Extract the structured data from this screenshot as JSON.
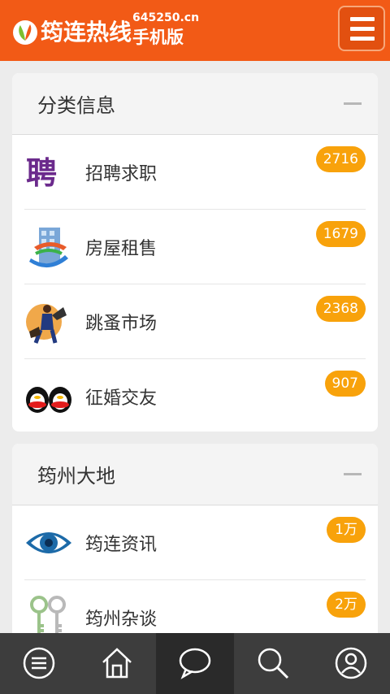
{
  "header": {
    "logo_icon": "leaf-logo-icon",
    "title": "筠连热线",
    "domain": "645250.cn",
    "subtitle": "手机版",
    "menu_icon": "hamburger-menu-icon",
    "brand_color": "#f25a16"
  },
  "sections": [
    {
      "title": "分类信息",
      "items": [
        {
          "label": "招聘求职",
          "count": "2716",
          "icon": "recruitment-icon"
        },
        {
          "label": "房屋租售",
          "count": "1679",
          "icon": "building-icon"
        },
        {
          "label": "跳蚤市场",
          "count": "2368",
          "icon": "megaphone-man-icon"
        },
        {
          "label": "征婚交友",
          "count": "907",
          "icon": "penguins-icon"
        }
      ]
    },
    {
      "title": "筠州大地",
      "items": [
        {
          "label": "筠连资讯",
          "count": "1万",
          "icon": "eye-icon"
        },
        {
          "label": "筠州杂谈",
          "count": "2万",
          "icon": "keys-icon"
        }
      ]
    }
  ],
  "bottom_nav": [
    {
      "icon": "menu-list-icon",
      "active": false
    },
    {
      "icon": "home-icon",
      "active": false
    },
    {
      "icon": "chat-bubble-icon",
      "active": true
    },
    {
      "icon": "search-icon",
      "active": false
    },
    {
      "icon": "user-icon",
      "active": false
    }
  ],
  "badge_color": "#f8a20b"
}
